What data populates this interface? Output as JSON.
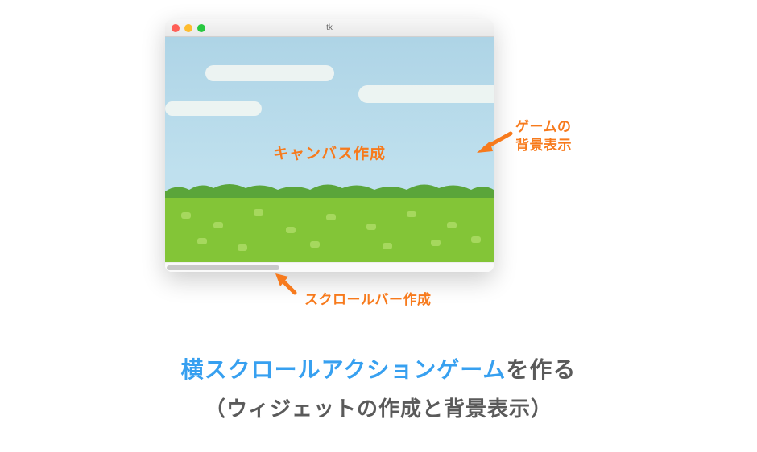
{
  "window": {
    "title": "tk"
  },
  "annotations": {
    "canvas": "キャンバス作成",
    "background_line1": "ゲームの",
    "background_line2": "背景表示",
    "scrollbar": "スクロールバー作成"
  },
  "caption": {
    "highlight": "横スクロールアクションゲーム",
    "rest": "を作る",
    "line2": "（ウィジェットの作成と背景表示）"
  }
}
